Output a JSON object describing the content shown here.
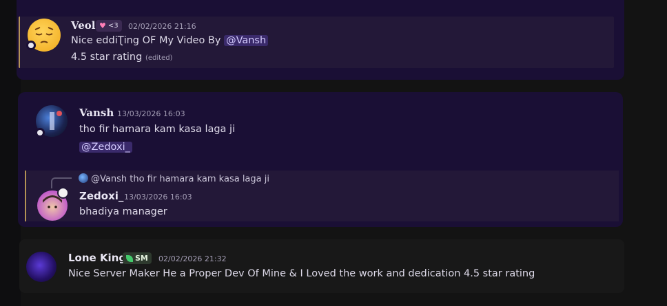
{
  "messages": [
    {
      "username": "Veol",
      "badge": {
        "icon": "heart-icon",
        "text": "<3"
      },
      "timestamp": "02/02/2026 21:16",
      "text_prefix": "Nice eddiƮing OF My Video By ",
      "mention": "@Vansh",
      "line2": "4.5 star rating",
      "edited": "(edited)"
    },
    {
      "username": "Vansh",
      "timestamp": "13/03/2026 16:03",
      "text": "tho fir hamara kam kasa laga ji",
      "mention": "@Zedoxi_"
    },
    {
      "reply_to": {
        "mention": "@Vansh",
        "text": "tho fir hamara kam kasa laga ji"
      },
      "username": "Zedoxi_",
      "timestamp": "13/03/2026 16:03",
      "text": "bhadiya manager"
    },
    {
      "username": "Lone King",
      "badge": {
        "icon": "leaf-icon",
        "text": "SM"
      },
      "timestamp": "02/02/2026 21:32",
      "text": "Nice Server Maker He a Proper Dev Of Mine & I Loved the work and dedication 4.5 star rating"
    }
  ],
  "colors": {
    "card_bg": "#1a0f35",
    "highlight_bg": "#231838",
    "accent_bar": "#b29255",
    "mention_bg": "#3a2a6b"
  }
}
